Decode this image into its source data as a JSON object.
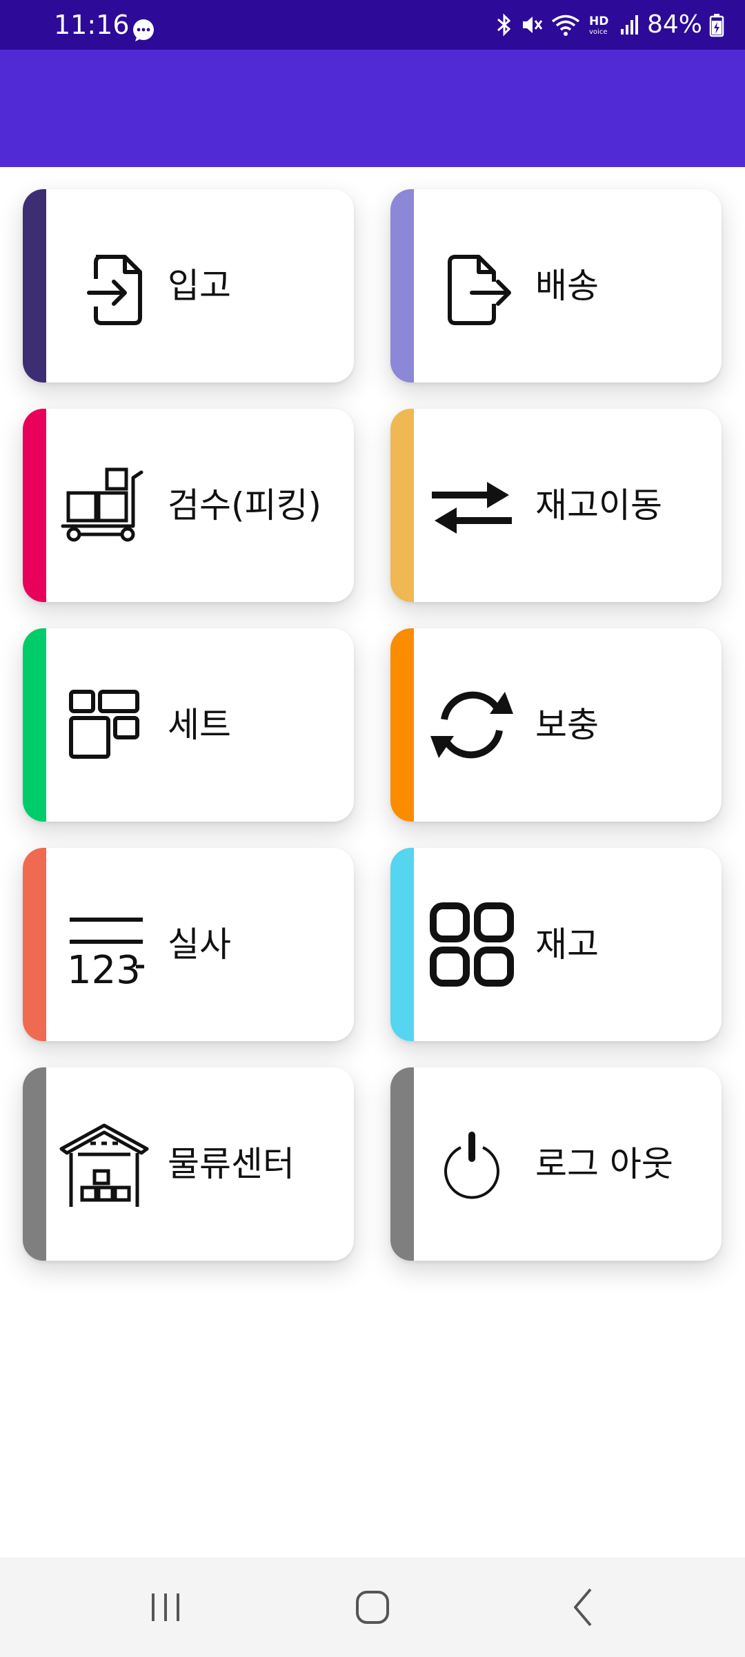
{
  "status_bar": {
    "time": "11:16",
    "battery": "84%",
    "icons": [
      "chat-bubble-icon",
      "bluetooth-icon",
      "mute-icon",
      "wifi-icon",
      "hd-voice-icon",
      "signal-icon",
      "battery-charging-icon"
    ]
  },
  "app_bar": {
    "color": "#512ad6"
  },
  "menu": {
    "items": [
      {
        "label": "입고",
        "icon": "file-import-icon",
        "accent": "#3d2e74"
      },
      {
        "label": "배송",
        "icon": "file-export-icon",
        "accent": "#8c87d6"
      },
      {
        "label": "검수(피킹)",
        "icon": "cart-boxes-icon",
        "accent": "#e8005a"
      },
      {
        "label": "재고이동",
        "icon": "swap-arrows-icon",
        "accent": "#efb853"
      },
      {
        "label": "세트",
        "icon": "set-grid-icon",
        "accent": "#00cc6a"
      },
      {
        "label": "보충",
        "icon": "refresh-icon",
        "accent": "#fb8c00"
      },
      {
        "label": "실사",
        "icon": "count-123-icon",
        "accent": "#f06a52"
      },
      {
        "label": "재고",
        "icon": "apps-grid-icon",
        "accent": "#55d5ef"
      },
      {
        "label": "물류센터",
        "icon": "warehouse-icon",
        "accent": "#7f7f7f"
      },
      {
        "label": "로그 아웃",
        "icon": "power-icon",
        "accent": "#7f7f7f"
      }
    ]
  },
  "nav_bar": {
    "buttons": [
      "recent-apps-icon",
      "home-icon",
      "back-icon"
    ]
  }
}
